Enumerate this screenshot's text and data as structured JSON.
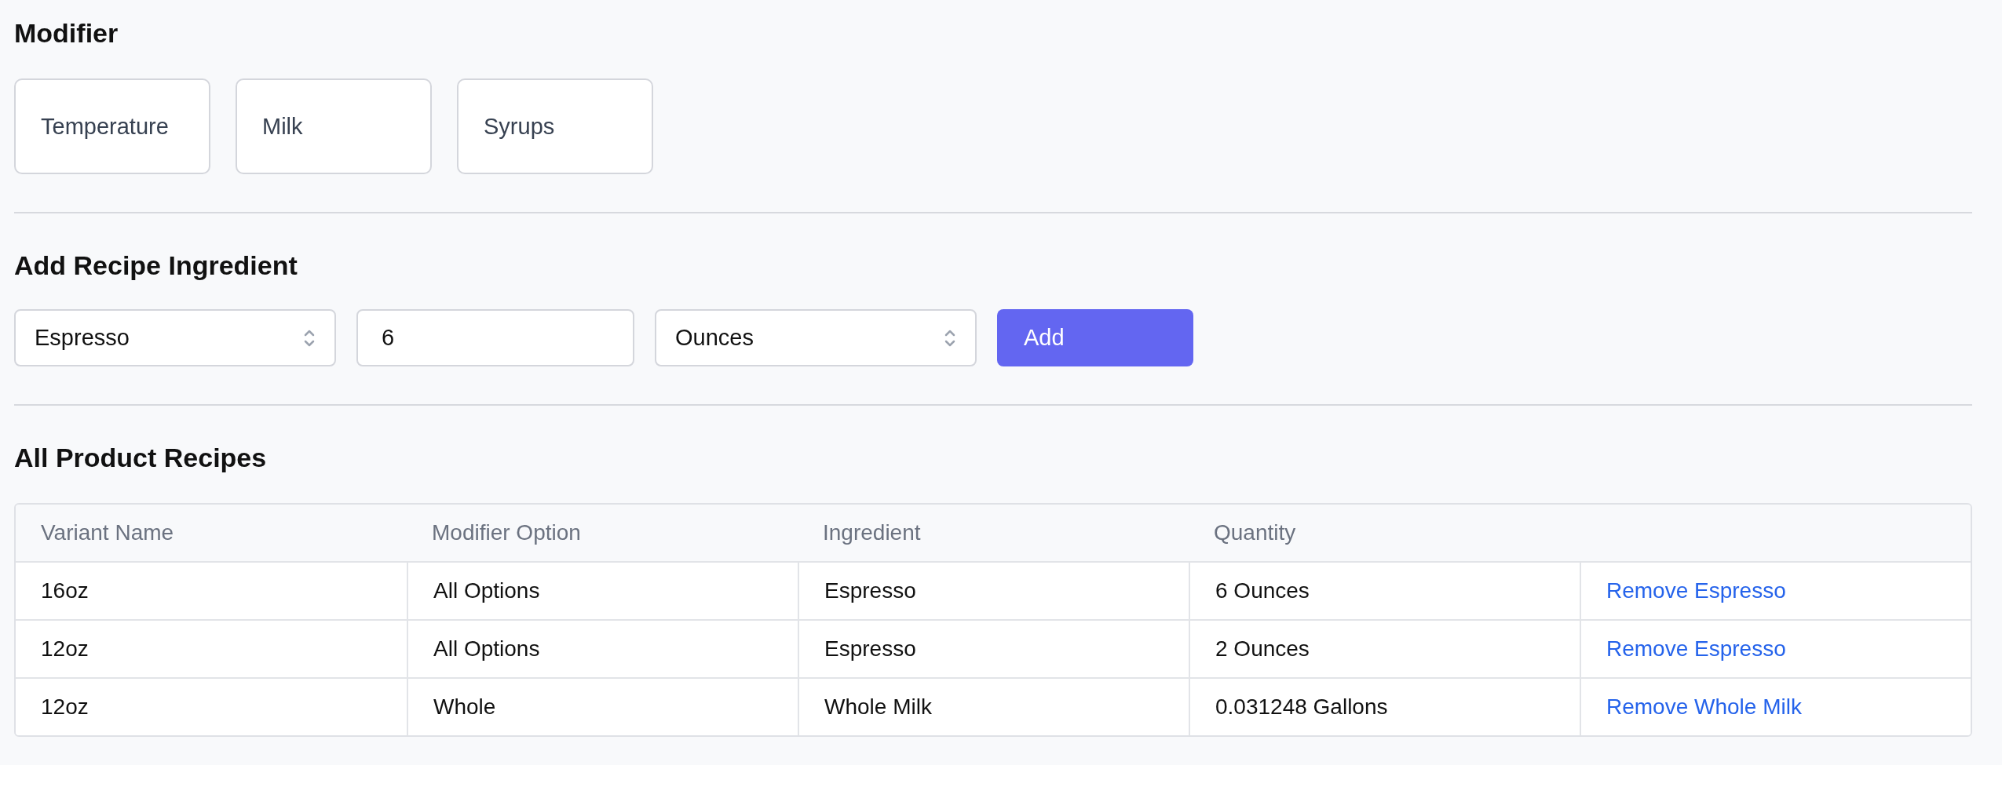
{
  "modifier": {
    "title": "Modifier",
    "options": [
      "Temperature",
      "Milk",
      "Syrups"
    ]
  },
  "add_ingredient": {
    "title": "Add Recipe Ingredient",
    "ingredient": "Espresso",
    "quantity": "6",
    "unit": "Ounces",
    "button": "Add"
  },
  "recipes": {
    "title": "All Product Recipes",
    "columns": [
      "Variant Name",
      "Modifier Option",
      "Ingredient",
      "Quantity"
    ],
    "rows": [
      {
        "cells": [
          "16oz",
          "All Options",
          "Espresso",
          "6 Ounces"
        ],
        "action": "Remove Espresso"
      },
      {
        "cells": [
          "12oz",
          "All Options",
          "Espresso",
          "2 Ounces"
        ],
        "action": "Remove Espresso"
      },
      {
        "cells": [
          "12oz",
          "Whole",
          "Whole Milk",
          "0.031248 Gallons"
        ],
        "action": "Remove Whole Milk"
      }
    ]
  }
}
